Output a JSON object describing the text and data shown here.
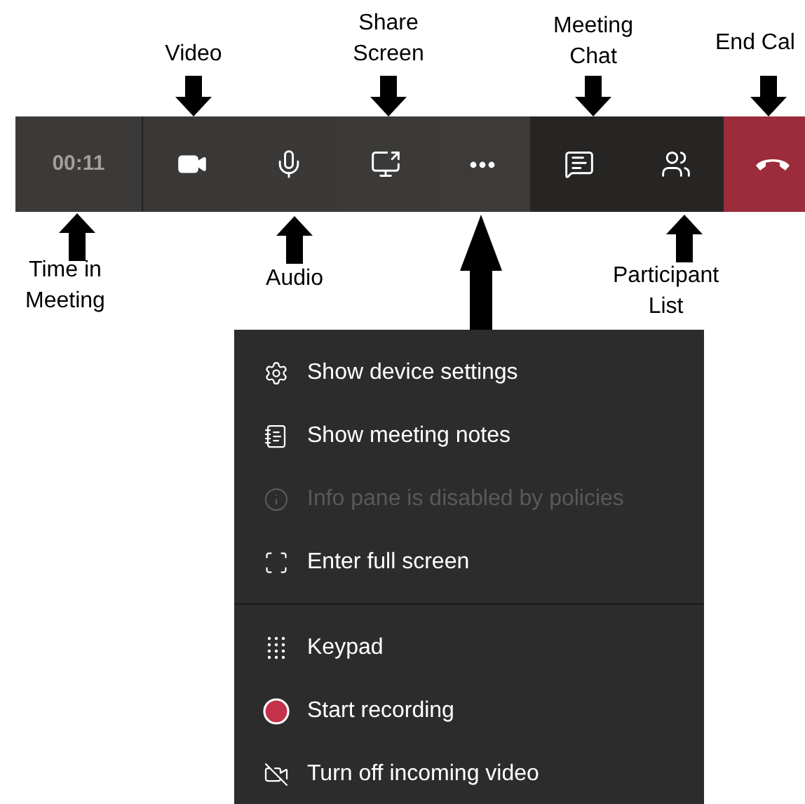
{
  "toolbar": {
    "timer": "00:11",
    "buttons": [
      {
        "kind": "video"
      },
      {
        "kind": "mic"
      },
      {
        "kind": "share"
      },
      {
        "kind": "more"
      },
      {
        "kind": "chat"
      },
      {
        "kind": "people"
      },
      {
        "kind": "hangup"
      }
    ]
  },
  "annotations": [
    {
      "lines": [
        "Video"
      ],
      "kind": "down"
    },
    {
      "lines": [
        "Share",
        "Screen"
      ],
      "kind": "down"
    },
    {
      "lines": [
        "Meeting",
        "Chat"
      ],
      "kind": "down"
    },
    {
      "lines": [
        "End Cal"
      ],
      "kind": "down"
    },
    {
      "lines": [
        "Time in",
        "Meeting"
      ],
      "kind": "up"
    },
    {
      "lines": [
        "Audio"
      ],
      "kind": "up"
    },
    {
      "kind": "big-up"
    },
    {
      "lines": [
        "Participant",
        "List"
      ],
      "kind": "up"
    }
  ],
  "menu": {
    "sections": [
      [
        {
          "kind": "settings",
          "label": "Show device settings",
          "disabled": false
        },
        {
          "kind": "notes",
          "label": "Show meeting notes",
          "disabled": false
        },
        {
          "kind": "info",
          "label": "Info pane is disabled by policies",
          "disabled": true
        },
        {
          "kind": "fullscreen",
          "label": "Enter full screen",
          "disabled": false
        }
      ],
      [
        {
          "kind": "keypad",
          "label": "Keypad",
          "disabled": false
        },
        {
          "kind": "record",
          "label": "Start recording",
          "disabled": false
        },
        {
          "kind": "video-off",
          "label": "Turn off incoming video",
          "disabled": false
        }
      ]
    ]
  }
}
